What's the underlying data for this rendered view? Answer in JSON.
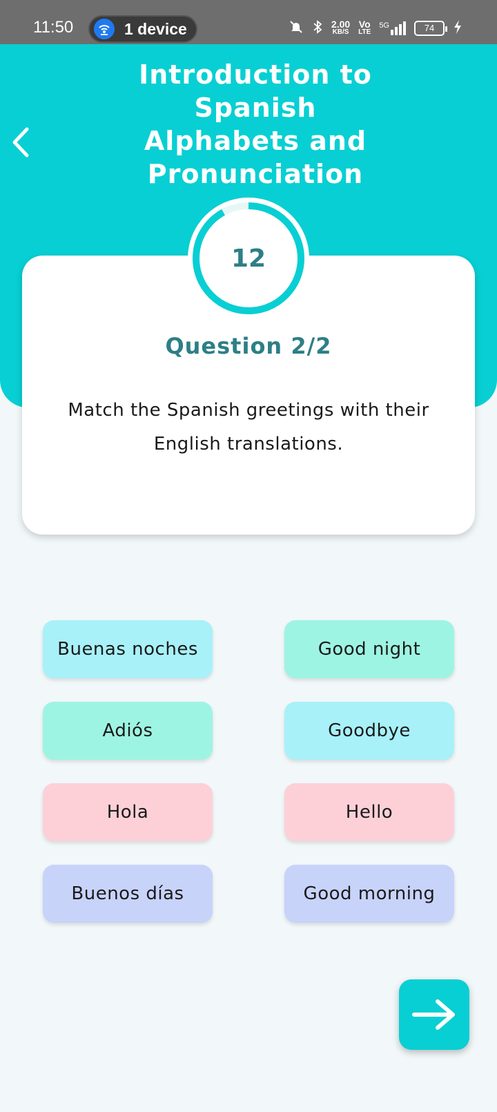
{
  "status_bar": {
    "time": "11:50",
    "hotspot_label": "1 device",
    "speed_value": "2.00",
    "speed_unit": "KB/S",
    "volte_top": "Vo",
    "volte_bottom": "LTE",
    "network": "5G",
    "battery": "74"
  },
  "header": {
    "title": "Introduction to Spanish Alphabets and Pronunciation"
  },
  "timer": {
    "value": "12",
    "fraction_remaining": 0.92
  },
  "question": {
    "label": "Question 2/2",
    "text": "Match the Spanish greetings with their English translations."
  },
  "pairs": {
    "left": [
      "Buenas noches",
      "Adiós",
      "Hola",
      "Buenos días"
    ],
    "right": [
      "Good night",
      "Goodbye",
      "Hello",
      "Good morning"
    ]
  },
  "colors": {
    "accent": "#08cfd3",
    "tile_cyan": "#a8f1f9",
    "tile_mint": "#9ef4e2",
    "tile_pink": "#fdd0d8",
    "tile_lavender": "#c8d3fa"
  },
  "icons": {
    "back": "chevron-left-icon",
    "next": "arrow-right-icon",
    "hotspot": "hotspot-icon"
  }
}
